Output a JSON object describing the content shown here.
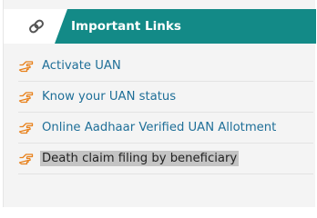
{
  "header": {
    "title": "Important Links",
    "icon": "link-icon",
    "background_color": "#138a87"
  },
  "links": [
    {
      "label": "Activate UAN",
      "icon": "hand-pointer-icon"
    },
    {
      "label": "Know your UAN status",
      "icon": "hand-pointer-icon"
    },
    {
      "label": "Online Aadhaar Verified UAN Allotment",
      "icon": "hand-pointer-icon"
    },
    {
      "label": "Death claim filing by beneficiary",
      "icon": "hand-pointer-icon",
      "selected": true
    }
  ],
  "colors": {
    "link": "#1f6f98",
    "icon": "#e8801a",
    "selection": "#c4c4c4"
  }
}
